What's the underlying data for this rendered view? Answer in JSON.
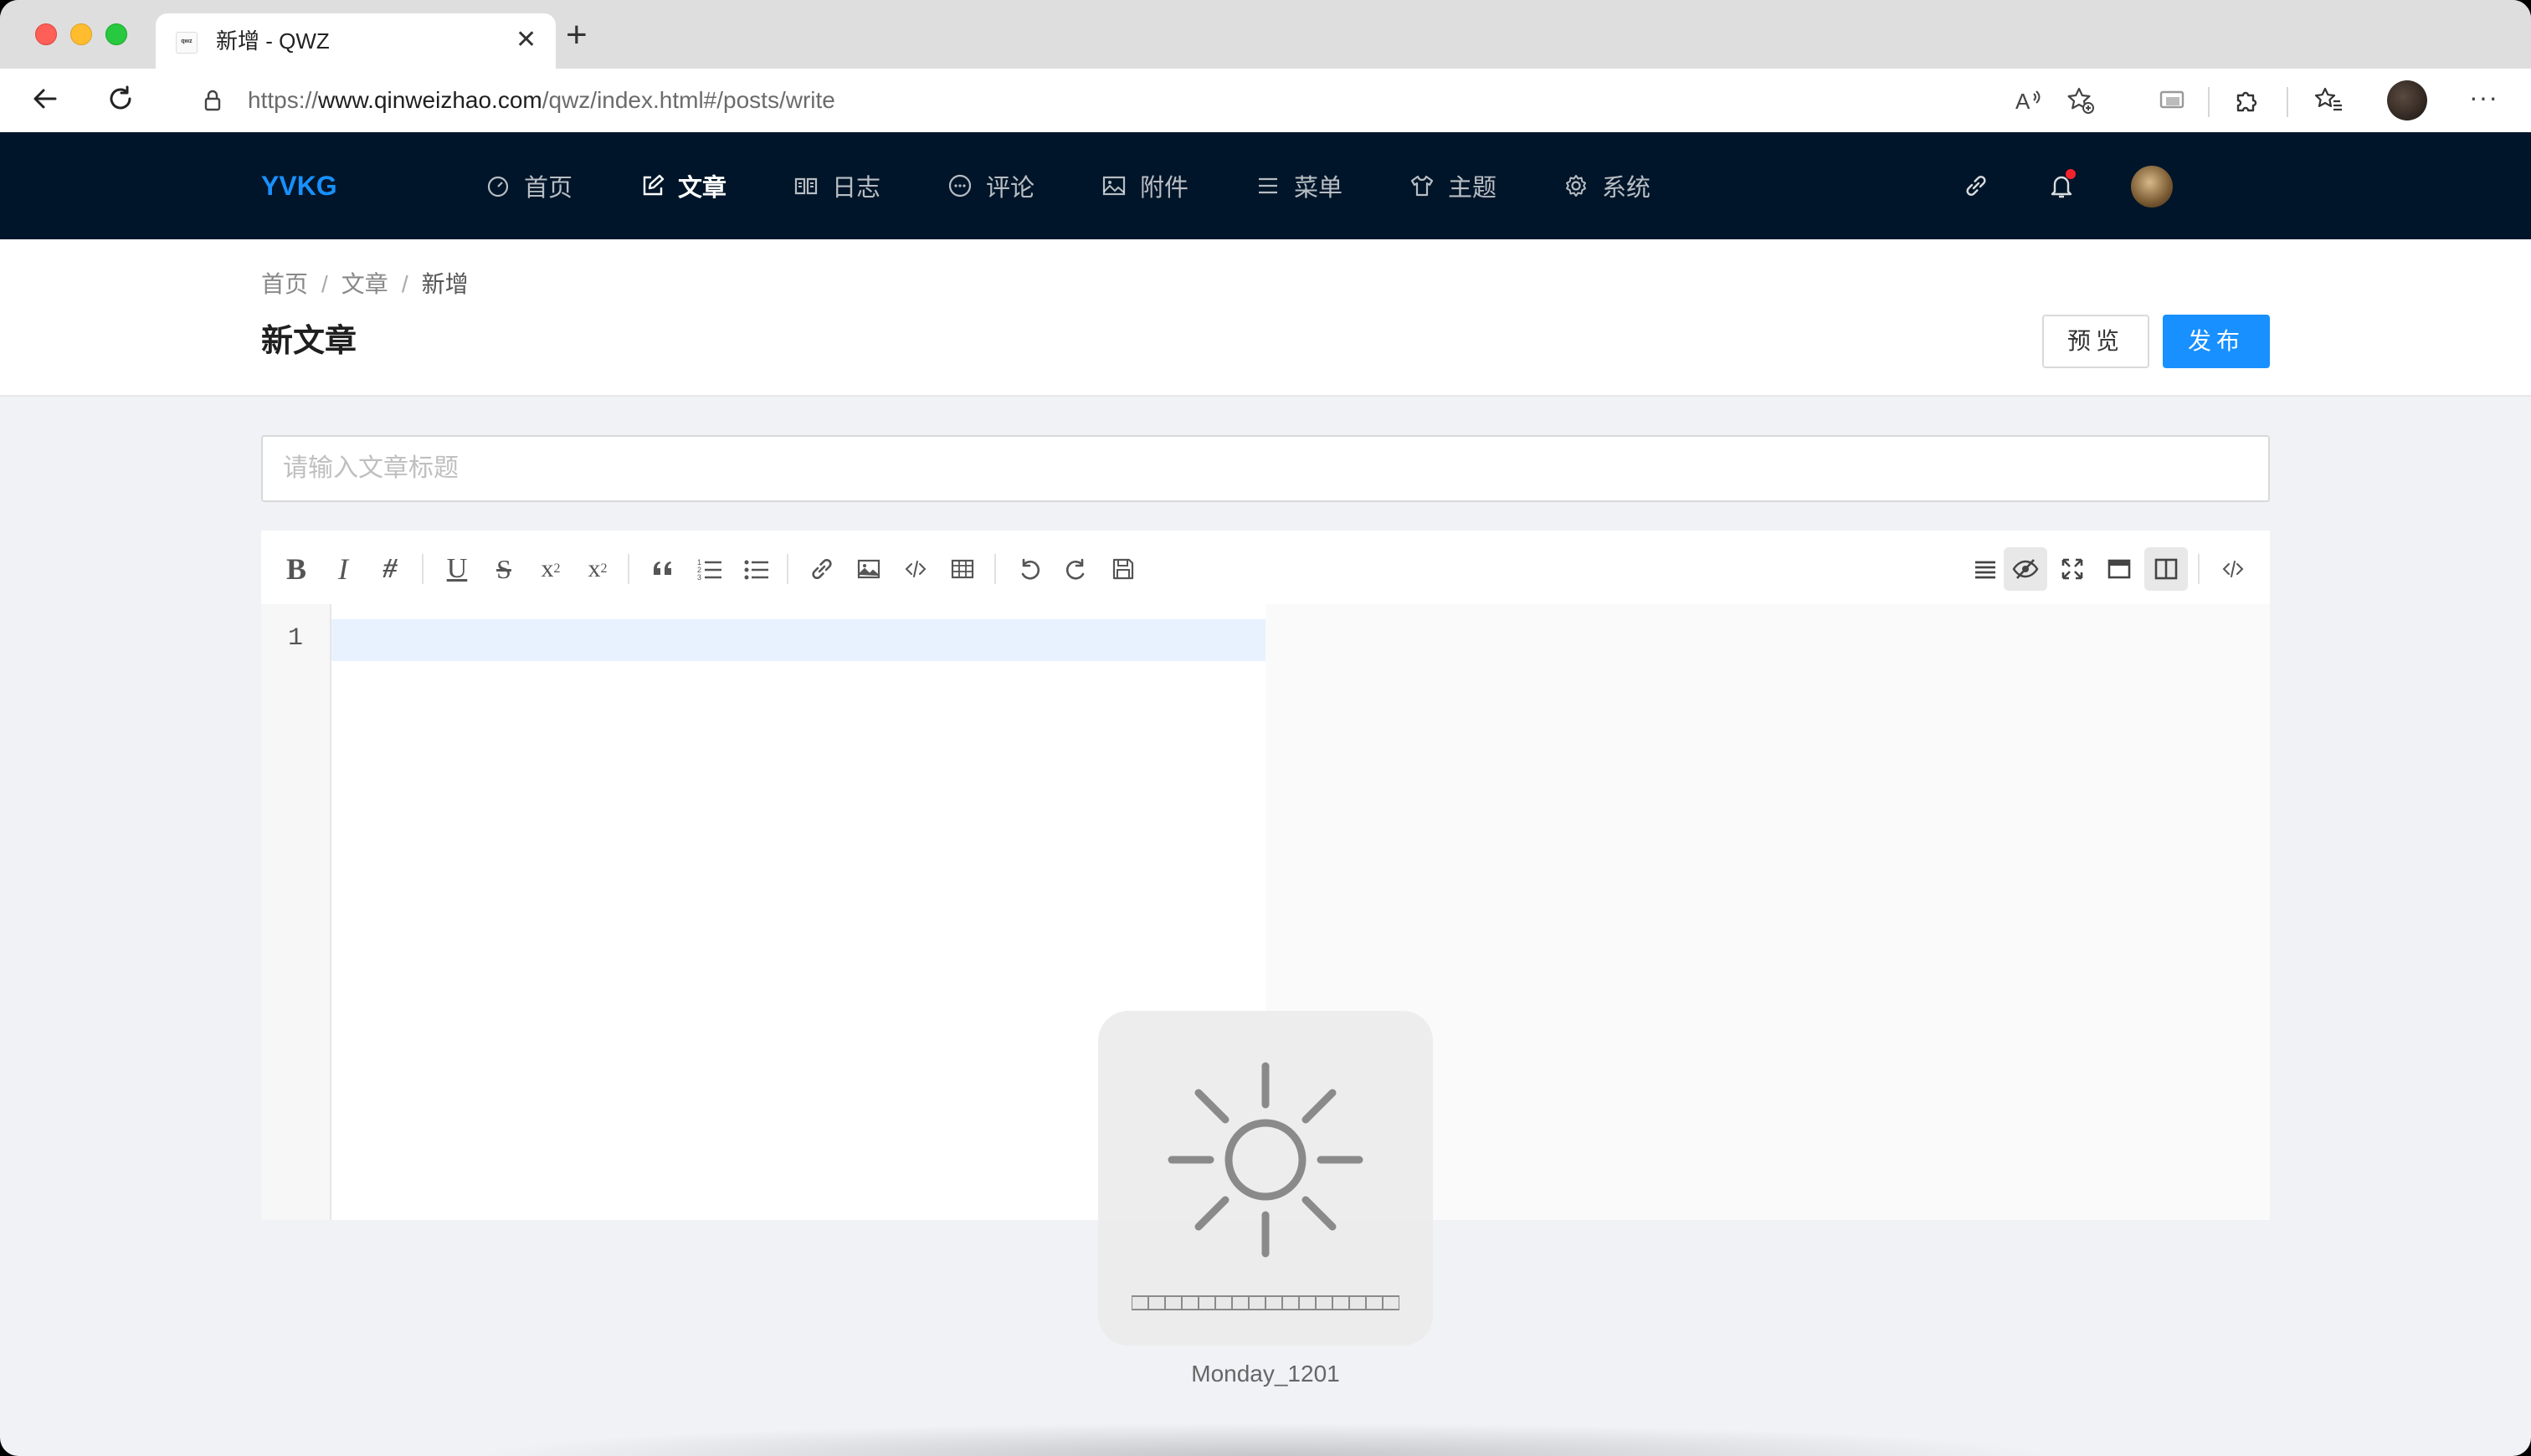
{
  "browser": {
    "tab_title": "新增 - QWZ",
    "favicon_text": "qwz",
    "url_prefix": "https://",
    "url_domain": "www.qinweizhao.com",
    "url_path": "/qwz/index.html#/posts/write"
  },
  "app": {
    "brand": "YVKG",
    "nav": [
      {
        "label": "首页",
        "icon": "dashboard-icon"
      },
      {
        "label": "文章",
        "icon": "edit-icon",
        "active": true
      },
      {
        "label": "日志",
        "icon": "book-icon"
      },
      {
        "label": "评论",
        "icon": "comment-icon"
      },
      {
        "label": "附件",
        "icon": "picture-icon"
      },
      {
        "label": "菜单",
        "icon": "menu-icon"
      },
      {
        "label": "主题",
        "icon": "shirt-icon"
      },
      {
        "label": "系统",
        "icon": "setting-icon"
      }
    ],
    "accent": "#1890ff",
    "header_bg": "#001529"
  },
  "page": {
    "breadcrumb": [
      "首页",
      "文章",
      "新增"
    ],
    "title": "新文章",
    "preview_label": "预览",
    "publish_label": "发布"
  },
  "editor": {
    "title_placeholder": "请输入文章标题",
    "title_value": "",
    "line_number": "1",
    "toolbar_left": [
      "bold-icon",
      "italic-icon",
      "heading-icon",
      "underline-icon",
      "strikethrough-icon",
      "superscript-icon",
      "subscript-icon",
      "quote-icon",
      "ordered-list-icon",
      "unordered-list-icon",
      "link-icon",
      "image-icon",
      "code-icon",
      "table-icon",
      "undo-icon",
      "redo-icon",
      "save-icon"
    ],
    "toolbar_right": [
      "navigation-icon",
      "preview-toggle-icon",
      "fullscreen-icon",
      "page-fullscreen-icon",
      "split-view-icon",
      "html-code-icon"
    ]
  },
  "overlay": {
    "icon": "brightness-sun-icon",
    "label": "Monday_1201",
    "level_segments": 16,
    "level": 0
  }
}
